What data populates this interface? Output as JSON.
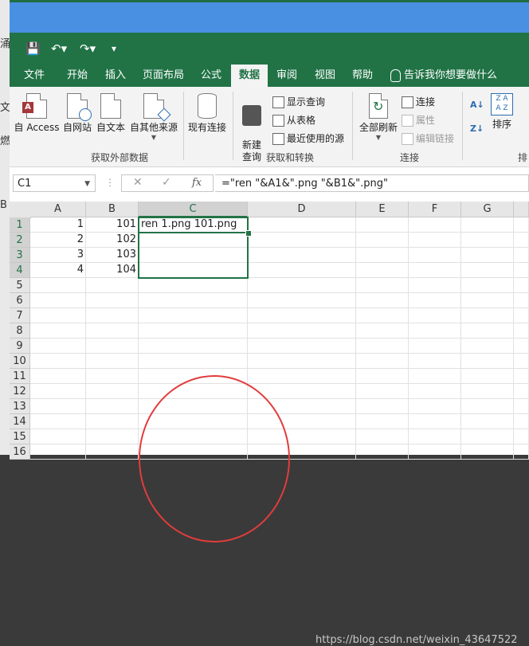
{
  "qat": {
    "save": "save-icon",
    "undo": "undo-icon",
    "redo": "redo-icon"
  },
  "tabs": [
    "文件",
    "开始",
    "插入",
    "页面布局",
    "公式",
    "数据",
    "审阅",
    "视图",
    "帮助"
  ],
  "active_tab": "数据",
  "tell_me": "告诉我你想要做什么",
  "ribbon": {
    "get_external": {
      "buttons": [
        "自 Access",
        "自网站",
        "自文本",
        "自其他来源"
      ],
      "existing_connections": "现有连接",
      "group_label": "获取外部数据"
    },
    "get_transform": {
      "new_query": "新建\n查询",
      "show_queries": "显示查询",
      "from_table": "从表格",
      "recent_sources": "最近使用的源",
      "group_label": "获取和转换"
    },
    "connections": {
      "refresh_all": "全部刷新",
      "connections": "连接",
      "properties": "属性",
      "edit_links": "编辑链接",
      "group_label": "连接"
    },
    "sort": {
      "sort": "排序",
      "group_label_partial": "排"
    }
  },
  "formula_bar": {
    "name_box": "C1",
    "fx": "fx",
    "formula": "=\"ren \"&A1&\".png \"&B1&\".png\""
  },
  "sheet": {
    "columns": [
      "A",
      "B",
      "C",
      "D",
      "E",
      "F",
      "G"
    ],
    "rows": [
      "1",
      "2",
      "3",
      "4",
      "5",
      "6",
      "7",
      "8",
      "9",
      "10",
      "11",
      "12",
      "13",
      "14",
      "15",
      "16"
    ],
    "cells": {
      "A": [
        "1",
        "2",
        "3",
        "4"
      ],
      "B": [
        "101",
        "102",
        "103",
        "104"
      ],
      "C1": "ren 1.png 101.png"
    }
  },
  "background_window": {
    "chars": [
      "涌",
      "文",
      "燃",
      "B"
    ]
  },
  "watermark": "https://blog.csdn.net/weixin_43647522",
  "colors": {
    "excel_green": "#217346",
    "annotation_red": "#e23c3c",
    "title_blue": "#4a90e2"
  }
}
